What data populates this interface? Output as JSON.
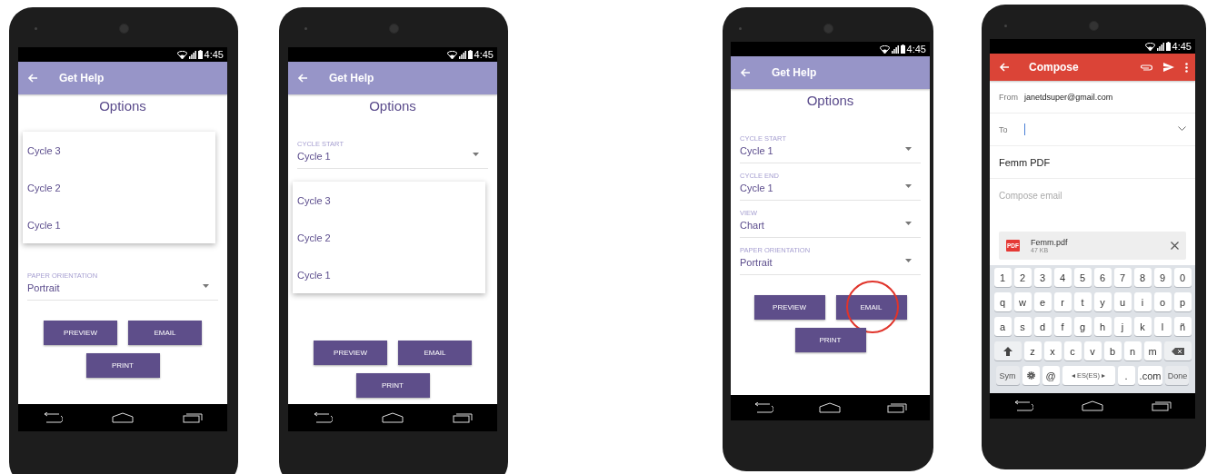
{
  "phones": [
    {
      "kind": "options",
      "status_time": "4:45",
      "app_title": "Get Help",
      "heading": "Options",
      "sections": [
        {
          "kind": "menu",
          "options": [
            "Cycle 3",
            "Cycle 2",
            "Cycle 1"
          ]
        },
        {
          "kind": "field",
          "label": "PAPER ORIENTATION",
          "value": "Portrait"
        }
      ],
      "buttons": [
        {
          "label": "PREVIEW",
          "highlighted": false
        },
        {
          "label": "EMAIL",
          "highlighted": false
        },
        {
          "label": "PRINT",
          "highlighted": false
        }
      ]
    },
    {
      "kind": "options",
      "status_time": "4:45",
      "app_title": "Get Help",
      "heading": "Options",
      "sections": [
        {
          "kind": "field",
          "label": "CYCLE START",
          "value": "Cycle 1"
        },
        {
          "kind": "menu",
          "options": [
            "Cycle 3",
            "Cycle 2",
            "Cycle 1"
          ]
        }
      ],
      "buttons": [
        {
          "label": "PREVIEW",
          "highlighted": false
        },
        {
          "label": "EMAIL",
          "highlighted": false
        },
        {
          "label": "PRINT",
          "highlighted": false
        }
      ]
    },
    {
      "kind": "options",
      "status_time": "4:45",
      "app_title": "Get Help",
      "heading": "Options",
      "sections": [
        {
          "kind": "field",
          "label": "CYCLE START",
          "value": "Cycle 1"
        },
        {
          "kind": "field",
          "label": "CYCLE END",
          "value": "Cycle 1"
        },
        {
          "kind": "field",
          "label": "VIEW",
          "value": "Chart"
        },
        {
          "kind": "field",
          "label": "PAPER ORIENTATION",
          "value": "Portrait"
        }
      ],
      "buttons": [
        {
          "label": "PREVIEW",
          "highlighted": false
        },
        {
          "label": "EMAIL",
          "highlighted": true
        },
        {
          "label": "PRINT",
          "highlighted": false
        }
      ]
    },
    {
      "kind": "compose",
      "status_time": "4:45",
      "app_title": "Compose",
      "from_label": "From",
      "from_value": "janetdsuper@gmail.com",
      "to_label": "To",
      "subject": "Femm PDF",
      "body": {
        "placeholder": "Compose email"
      },
      "attachment": {
        "badge": "PDF",
        "name": "Femm.pdf",
        "size": "47 KB"
      },
      "keyboard": [
        [
          {
            "kind": "char",
            "label": "1"
          },
          {
            "kind": "char",
            "label": "2"
          },
          {
            "kind": "char",
            "label": "3"
          },
          {
            "kind": "char",
            "label": "4"
          },
          {
            "kind": "char",
            "label": "5"
          },
          {
            "kind": "char",
            "label": "6"
          },
          {
            "kind": "char",
            "label": "7"
          },
          {
            "kind": "char",
            "label": "8"
          },
          {
            "kind": "char",
            "label": "9"
          },
          {
            "kind": "char",
            "label": "0"
          }
        ],
        [
          {
            "kind": "char",
            "label": "q"
          },
          {
            "kind": "char",
            "label": "w"
          },
          {
            "kind": "char",
            "label": "e"
          },
          {
            "kind": "char",
            "label": "r"
          },
          {
            "kind": "char",
            "label": "t"
          },
          {
            "kind": "char",
            "label": "y"
          },
          {
            "kind": "char",
            "label": "u"
          },
          {
            "kind": "char",
            "label": "i"
          },
          {
            "kind": "char",
            "label": "o"
          },
          {
            "kind": "char",
            "label": "p"
          }
        ],
        [
          {
            "kind": "char",
            "label": "a"
          },
          {
            "kind": "char",
            "label": "s"
          },
          {
            "kind": "char",
            "label": "d"
          },
          {
            "kind": "char",
            "label": "f"
          },
          {
            "kind": "char",
            "label": "g"
          },
          {
            "kind": "char",
            "label": "h"
          },
          {
            "kind": "char",
            "label": "j"
          },
          {
            "kind": "char",
            "label": "k"
          },
          {
            "kind": "char",
            "label": "l"
          },
          {
            "kind": "char",
            "label": "ñ"
          }
        ],
        [
          {
            "kind": "shift"
          },
          {
            "kind": "char",
            "label": "z"
          },
          {
            "kind": "char",
            "label": "x"
          },
          {
            "kind": "char",
            "label": "c"
          },
          {
            "kind": "char",
            "label": "v"
          },
          {
            "kind": "char",
            "label": "b"
          },
          {
            "kind": "char",
            "label": "n"
          },
          {
            "kind": "char",
            "label": "m"
          },
          {
            "kind": "backspace"
          }
        ],
        [
          {
            "kind": "function",
            "label": "Sym"
          },
          {
            "kind": "settings"
          },
          {
            "kind": "char",
            "label": "@"
          },
          {
            "kind": "space",
            "label": "◂ ES(ES) ▸"
          },
          {
            "kind": "char",
            "label": "."
          },
          {
            "kind": "char",
            "label": ".com"
          },
          {
            "kind": "function",
            "label": "Done"
          }
        ]
      ]
    }
  ]
}
